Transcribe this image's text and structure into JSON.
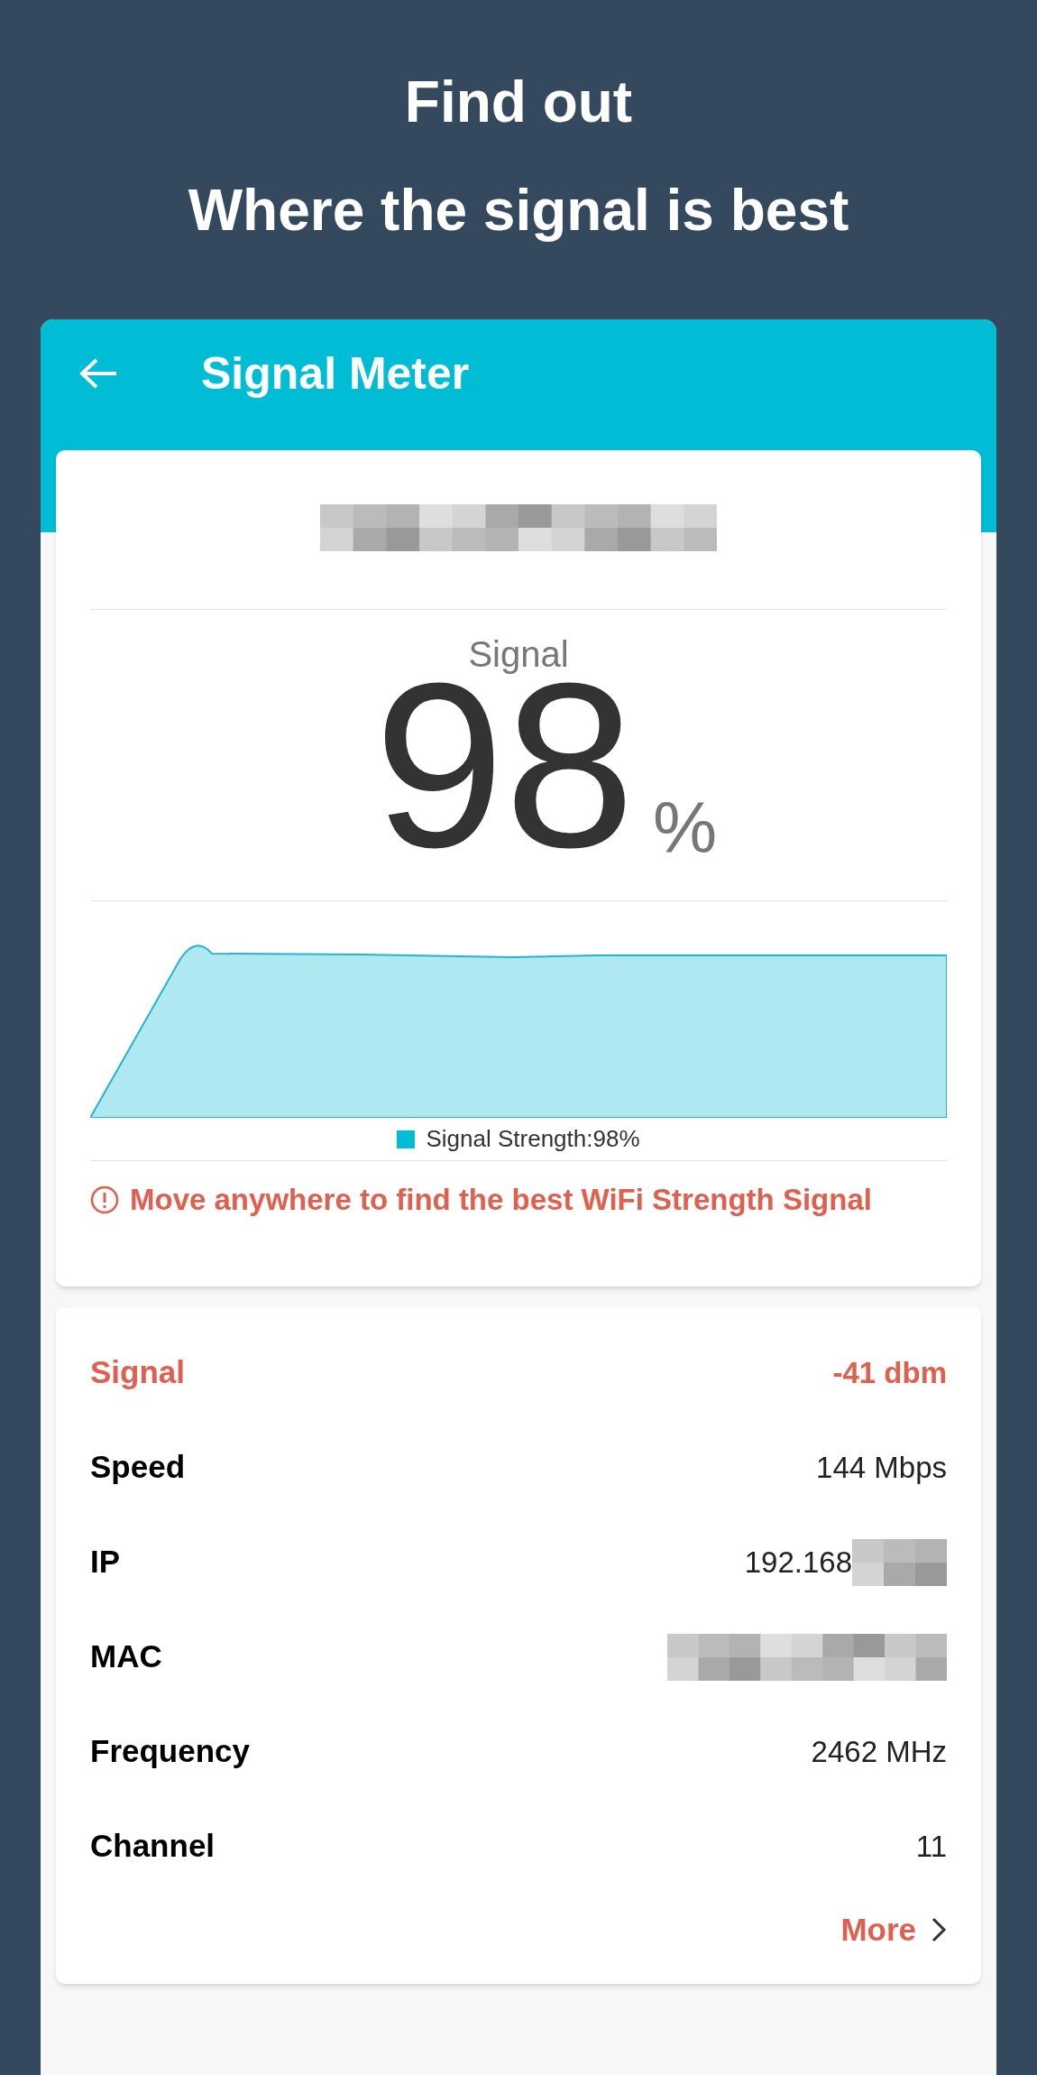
{
  "heading": [
    "Find out",
    "Where the signal is best"
  ],
  "app_bar": {
    "title": "Signal Meter"
  },
  "signal_card": {
    "label": "Signal",
    "value": "98",
    "unit": "%",
    "legend": "Signal Strength:98%",
    "warning": "Move anywhere to find the best WiFi Strength Signal"
  },
  "details": {
    "rows": [
      {
        "label": "Signal",
        "value": "-41 dbm",
        "kind": "highlight"
      },
      {
        "label": "Speed",
        "value": "144 Mbps",
        "kind": "plain"
      },
      {
        "label": "IP",
        "value": "192.168",
        "kind": "partial"
      },
      {
        "label": "MAC",
        "kind": "hidden"
      },
      {
        "label": "Frequency",
        "value": "2462 MHz",
        "kind": "plain"
      },
      {
        "label": "Channel",
        "value": "11",
        "kind": "plain"
      }
    ],
    "more": "More"
  }
}
